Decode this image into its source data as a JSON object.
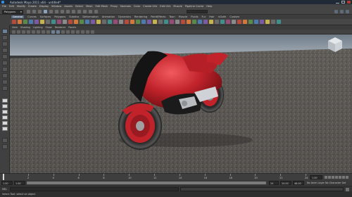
{
  "window": {
    "title": "Autodesk Maya 2011 x64 - untitled*"
  },
  "menubar": {
    "items": [
      "File",
      "Edit",
      "Modify",
      "Create",
      "Display",
      "Window",
      "Assets",
      "Select",
      "Mesh",
      "Edit Mesh",
      "Proxy",
      "Normals",
      "Color",
      "Create UVs",
      "Edit UVs",
      "Muscle",
      "Pipeline Cache",
      "Help"
    ]
  },
  "statusline": {
    "mode": "Polygons"
  },
  "shelf": {
    "tabs": [
      "General",
      "Curves",
      "Surfaces",
      "Polygons",
      "Subdivs",
      "Deformation",
      "Animation",
      "Dynamics",
      "Rendering",
      "PaintEffects",
      "Toon",
      "Muscle",
      "Fluids",
      "Fur",
      "Hair",
      "nCloth",
      "Custom"
    ],
    "active_tab": "General"
  },
  "panel": {
    "menu": [
      "View",
      "Shading",
      "Lighting",
      "Show",
      "Renderer",
      "Panels"
    ]
  },
  "timeline": {
    "ticks": [
      "1",
      "2",
      "4",
      "6",
      "8",
      "10",
      "12",
      "14",
      "16",
      "18",
      "20",
      "22",
      "24"
    ],
    "current_frame": "1.00"
  },
  "range": {
    "start": "1.00",
    "start_inner": "1.00",
    "end_inner": "24",
    "end": "24.00",
    "end_total": "48.00",
    "anim_layer": "No Anim Layer",
    "char_set": "No Character Set"
  },
  "cmdline": {
    "label": "MEL"
  },
  "helpline": {
    "text": "Select Tool: select an object"
  },
  "colors": {
    "accent": "#5a6b80",
    "bike_red": "#c2232b",
    "ground": "#5b5854"
  }
}
